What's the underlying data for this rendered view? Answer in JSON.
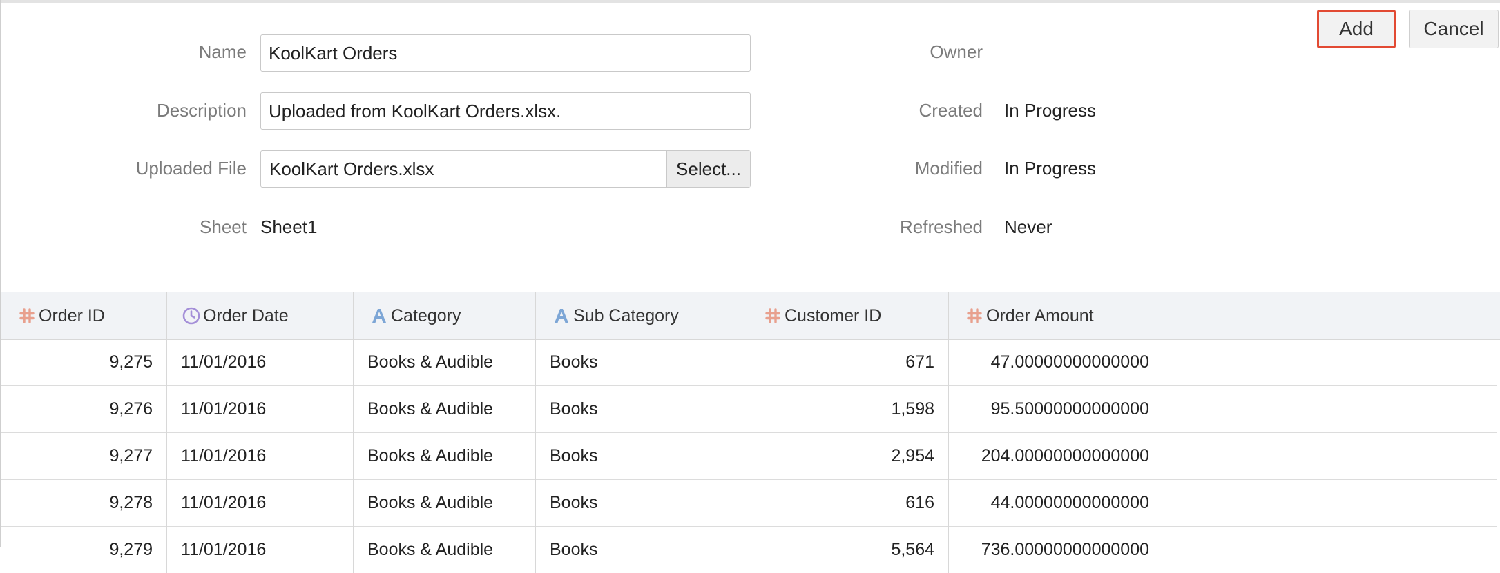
{
  "toolbar": {
    "add_label": "Add",
    "cancel_label": "Cancel"
  },
  "form": {
    "name_label": "Name",
    "name_value": "KoolKart Orders",
    "description_label": "Description",
    "description_value": "Uploaded from KoolKart Orders.xlsx.",
    "file_label": "Uploaded File",
    "file_value": "KoolKart Orders.xlsx",
    "select_label": "Select...",
    "sheet_label": "Sheet",
    "sheet_value": "Sheet1"
  },
  "info": {
    "owner_label": "Owner",
    "owner_value": "",
    "created_label": "Created",
    "created_value": "In Progress",
    "modified_label": "Modified",
    "modified_value": "In Progress",
    "refreshed_label": "Refreshed",
    "refreshed_value": "Never"
  },
  "grid": {
    "columns": [
      {
        "label": "Order ID",
        "icon": "hash-icon"
      },
      {
        "label": "Order Date",
        "icon": "clock-icon"
      },
      {
        "label": "Category",
        "icon": "text-a-icon"
      },
      {
        "label": "Sub Category",
        "icon": "text-a-icon"
      },
      {
        "label": "Customer ID",
        "icon": "hash-icon"
      },
      {
        "label": "Order Amount",
        "icon": "hash-icon"
      }
    ],
    "rows": [
      [
        "9,275",
        "11/01/2016",
        "Books & Audible",
        "Books",
        "671",
        "47.00000000000000"
      ],
      [
        "9,276",
        "11/01/2016",
        "Books & Audible",
        "Books",
        "1,598",
        "95.50000000000000"
      ],
      [
        "9,277",
        "11/01/2016",
        "Books & Audible",
        "Books",
        "2,954",
        "204.00000000000000"
      ],
      [
        "9,278",
        "11/01/2016",
        "Books & Audible",
        "Books",
        "616",
        "44.00000000000000"
      ],
      [
        "9,279",
        "11/01/2016",
        "Books & Audible",
        "Books",
        "5,564",
        "736.00000000000000"
      ]
    ]
  },
  "colors": {
    "accent_red": "#e24a33",
    "hash_icon": "#e8a08e",
    "clock_icon": "#a48fd8",
    "text_icon": "#7da6d6"
  }
}
